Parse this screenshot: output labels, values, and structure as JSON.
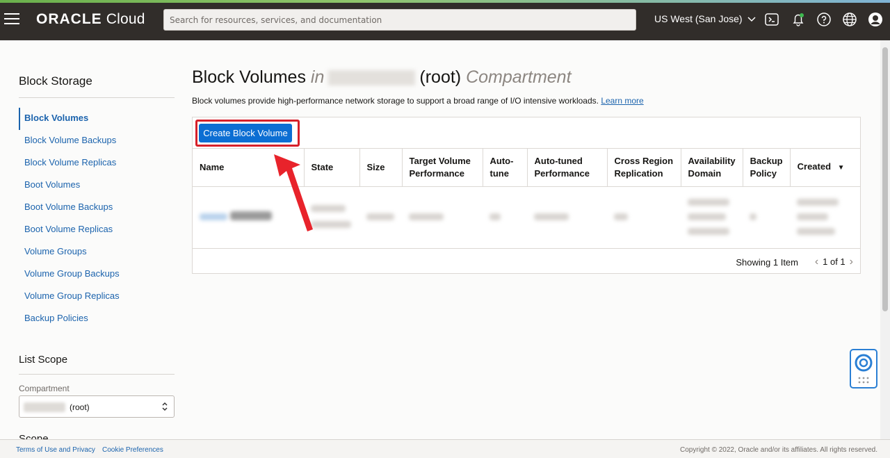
{
  "topbar": {
    "logo_main": "ORACLE",
    "logo_sub": "Cloud",
    "search_placeholder": "Search for resources, services, and documentation",
    "region": "US West (San Jose)",
    "icons": [
      "menu-icon",
      "cloud-shell-icon",
      "bell-icon",
      "help-icon",
      "globe-icon",
      "user-icon"
    ]
  },
  "sidebar": {
    "title": "Block Storage",
    "items": [
      {
        "label": "Block Volumes",
        "active": true
      },
      {
        "label": "Block Volume Backups"
      },
      {
        "label": "Block Volume Replicas"
      },
      {
        "label": "Boot Volumes"
      },
      {
        "label": "Boot Volume Backups"
      },
      {
        "label": "Boot Volume Replicas"
      },
      {
        "label": "Volume Groups"
      },
      {
        "label": "Volume Group Backups"
      },
      {
        "label": "Volume Group Replicas"
      },
      {
        "label": "Backup Policies"
      }
    ],
    "list_scope_title": "List Scope",
    "compartment_label": "Compartment",
    "compartment_value": "(root)",
    "scope_title": "Scope"
  },
  "main": {
    "title_start": "Block Volumes",
    "title_in": "in",
    "title_root": "(root)",
    "title_end": "Compartment",
    "description": "Block volumes provide high-performance network storage to support a broad range of I/O intensive workloads.",
    "learn_more": "Learn more",
    "create_button": "Create Block Volume",
    "columns": [
      "Name",
      "State",
      "Size",
      "Target Volume Performance",
      "Auto-tune",
      "Auto-tuned Performance",
      "Cross Region Replication",
      "Availability Domain",
      "Backup Policy",
      "Created"
    ],
    "sort_indicator": "▼",
    "showing": "Showing 1 Item",
    "page": "1 of 1"
  },
  "footer": {
    "terms": "Terms of Use and Privacy",
    "cookies": "Cookie Preferences",
    "copyright": "Copyright © 2022, Oracle and/or its affiliates. All rights reserved."
  },
  "colors": {
    "topbar": "#312d2a",
    "accent": "#0c6ed3",
    "link": "#1b63ad",
    "highlight": "#d6202a"
  }
}
